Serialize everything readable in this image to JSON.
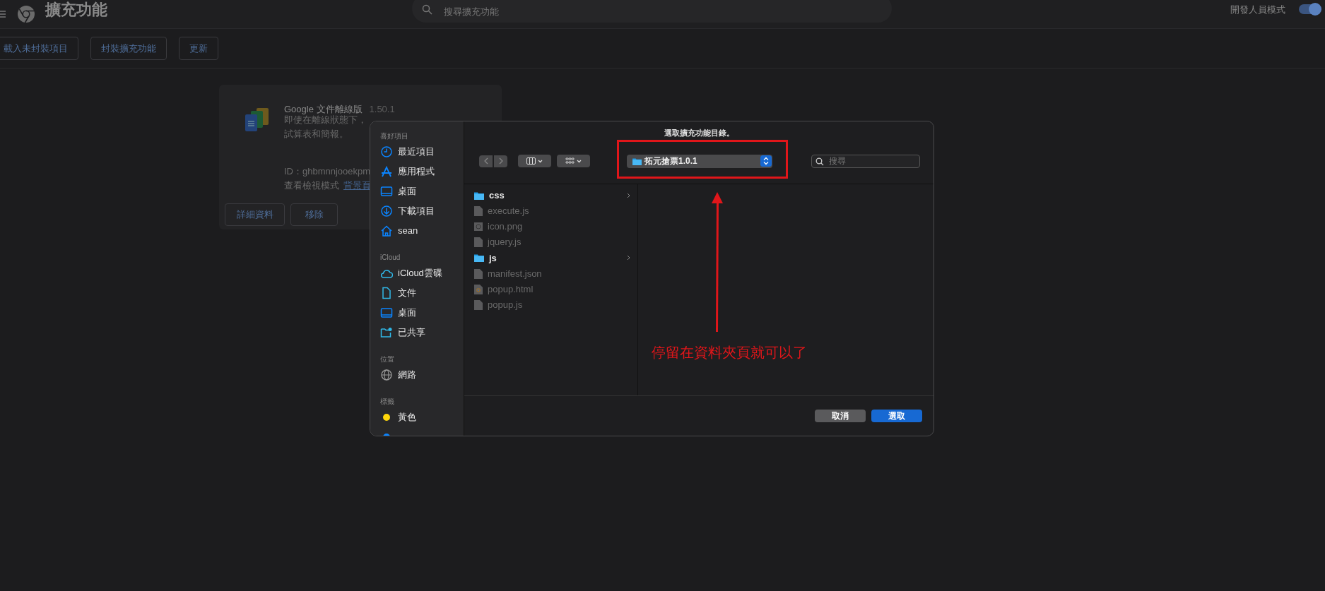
{
  "header": {
    "title": "擴充功能",
    "search_placeholder": "搜尋擴充功能",
    "dev_mode_label": "開發人員模式",
    "dev_mode_on": true
  },
  "toolbar": [
    "載入未封裝項目",
    "封裝擴充功能",
    "更新"
  ],
  "extension_card": {
    "name": "Google 文件離線版",
    "version": "1.50.1",
    "description": [
      "即使在離線狀態下，",
      "試算表和簡報。"
    ],
    "id": "ID：ghbmnnjooekpm",
    "inspect_label": "查看檢視模式",
    "inspect_link": "背景頁",
    "buttons": [
      "詳細資料",
      "移除"
    ]
  },
  "dialog": {
    "title": "選取擴充功能目錄。",
    "sidebar": [
      {
        "heading": "喜好項目",
        "items": [
          {
            "kind": "clock",
            "label": "最近項目"
          },
          {
            "kind": "apps",
            "label": "應用程式"
          },
          {
            "kind": "desktop",
            "label": "桌面"
          },
          {
            "kind": "download",
            "label": "下載項目"
          },
          {
            "kind": "home",
            "label": "sean"
          }
        ]
      },
      {
        "heading": "iCloud",
        "items": [
          {
            "kind": "cloud",
            "label": "iCloud雲碟"
          },
          {
            "kind": "document",
            "label": "文件"
          },
          {
            "kind": "desktop",
            "label": "桌面"
          },
          {
            "kind": "shared",
            "label": "已共享"
          }
        ]
      },
      {
        "heading": "位置",
        "items": [
          {
            "kind": "globe",
            "label": "網路"
          }
        ]
      },
      {
        "heading": "標籤",
        "items": [
          {
            "kind": "tag",
            "label": "黃色",
            "color": "#ffd60a"
          },
          {
            "kind": "tag",
            "color": "#0a84ff"
          }
        ]
      }
    ],
    "location": "拓元搶票1.0.1",
    "search_placeholder": "搜尋",
    "files": [
      {
        "kind": "folder",
        "name": "css",
        "disabled": false
      },
      {
        "kind": "file",
        "name": "execute.js",
        "disabled": true
      },
      {
        "kind": "image",
        "name": "icon.png",
        "disabled": true
      },
      {
        "kind": "file",
        "name": "jquery.js",
        "disabled": true
      },
      {
        "kind": "folder",
        "name": "js",
        "disabled": false
      },
      {
        "kind": "file",
        "name": "manifest.json",
        "disabled": true
      },
      {
        "kind": "html",
        "name": "popup.html",
        "disabled": true
      },
      {
        "kind": "file",
        "name": "popup.js",
        "disabled": true
      }
    ],
    "buttons": [
      {
        "label": "取消",
        "selected": false
      },
      {
        "label": "選取",
        "selected": true
      }
    ]
  },
  "annotation": {
    "text": "停留在資料夾頁就可以了"
  }
}
